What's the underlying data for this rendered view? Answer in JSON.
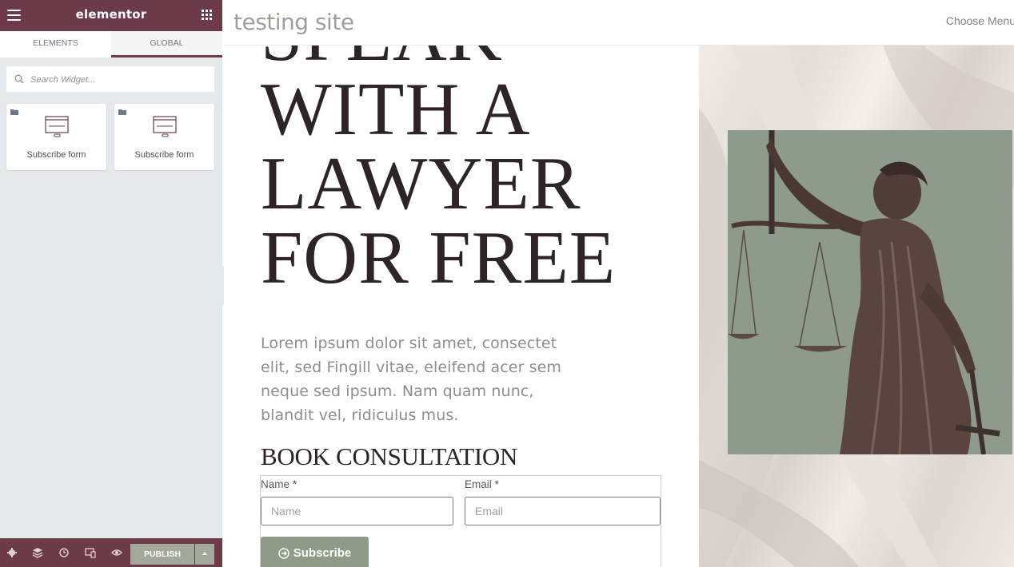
{
  "editor": {
    "logo": "elementor",
    "tabs": [
      {
        "label": "ELEMENTS",
        "active": false
      },
      {
        "label": "GLOBAL",
        "active": true
      }
    ],
    "search": {
      "placeholder": "Search Widget..."
    },
    "widgets": [
      {
        "label": "Subscribe form",
        "icon": "form-icon"
      },
      {
        "label": "Subscribe form",
        "icon": "form-icon"
      }
    ],
    "footer": {
      "icons": [
        "settings-icon",
        "navigator-icon",
        "history-icon",
        "responsive-icon",
        "preview-icon"
      ],
      "publish_label": "PUBLISH"
    },
    "colors": {
      "brand": "#6d3b47",
      "publish": "#a2a99a"
    }
  },
  "site": {
    "title": "testing site",
    "menu_label": "Choose Menu",
    "headline": [
      "SPEAK",
      "WITH A",
      "LAWYER",
      "FOR FREE"
    ],
    "body": "Lorem ipsum dolor sit amet, consectet elit, sed Fingill vitae, eleifend acer sem neque sed ipsum. Nam quam nunc, blandit vel, ridiculus mus.",
    "book_title": "BOOK CONSULTATION",
    "form": {
      "name_label": "Name",
      "name_placeholder": "Name",
      "email_label": "Email",
      "email_placeholder": "Email",
      "required_mark": "*",
      "submit_label": "Subscribe"
    },
    "colors": {
      "accent": "#8f9a88",
      "heading": "#2e2325"
    }
  }
}
